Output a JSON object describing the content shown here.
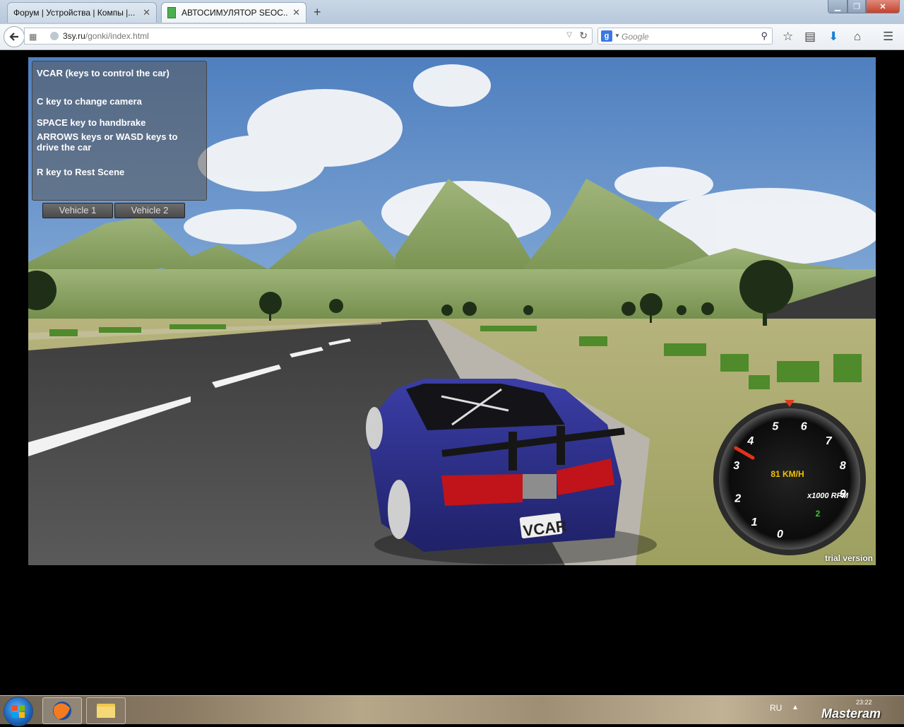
{
  "browser": {
    "tabs": [
      {
        "label": "Форум | Устройства | Компы |..."
      },
      {
        "label": "АВТОСИМУЛЯТОР SEOC..."
      }
    ],
    "new_tab": "+",
    "address": {
      "host": "3sy.ru",
      "path": "/gonki/index.html"
    },
    "search": {
      "engine_letter": "g",
      "placeholder": "Google"
    }
  },
  "game": {
    "info_lines": [
      "VCAR (keys to control the car)",
      "C key to change camera",
      "SPACE key to handbrake",
      "ARROWS keys or WASD keys to drive the car",
      "R key to Rest Scene"
    ],
    "vehicle_buttons": [
      "Vehicle 1",
      "Vehicle 2"
    ],
    "plate": "VCAR",
    "speedometer": {
      "speed": "81 KM/H",
      "unit": "x1000 RPM",
      "gear": "2",
      "ticks": [
        "0",
        "1",
        "2",
        "3",
        "4",
        "5",
        "6",
        "7",
        "8",
        "9"
      ],
      "rpm_value": 3.5
    },
    "trial": "trial version"
  },
  "taskbar": {
    "lang": "RU",
    "clock": "23:22",
    "watermark": "Masteram"
  },
  "colors": {
    "sky": "#6e98cc",
    "car_body": "#2d2f8a",
    "grass": "#8fa35a"
  }
}
